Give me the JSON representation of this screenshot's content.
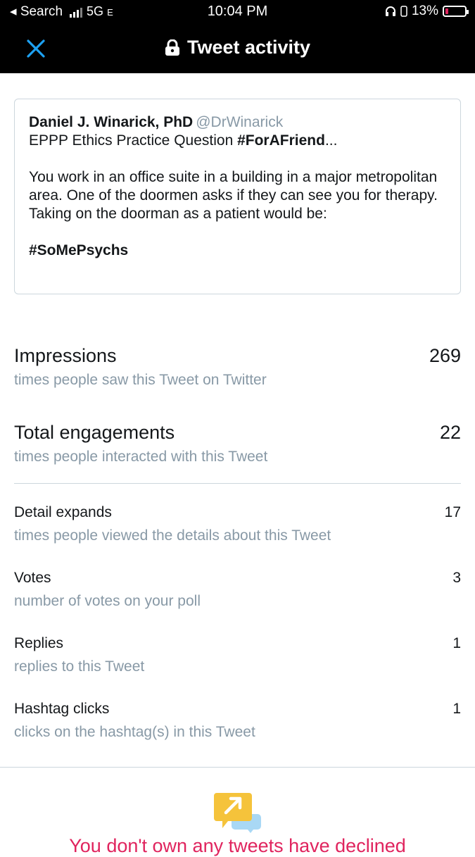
{
  "status_bar": {
    "back_app": "◂ Search",
    "network": "5G",
    "network_suffix": "E",
    "time": "10:04 PM",
    "battery": "13%"
  },
  "nav": {
    "title": "Tweet activity",
    "icons": {
      "close": "close-icon",
      "lock": "lock-icon"
    }
  },
  "tweet": {
    "author": "Daniel J. Winarick, PhD",
    "handle": "@DrWinarick",
    "line1_text": "EPPP Ethics Practice Question ",
    "line1_hashtag": "#ForAFriend",
    "line1_ellipsis": "...",
    "body": "You work in an office suite in a building in a major metropolitan area. One of the doormen asks if they can see you for therapy. Taking on the doorman as a patient would be:",
    "hashtag": "#SoMePsychs"
  },
  "metrics": [
    {
      "label": "Impressions",
      "desc": "times people saw this Tweet on Twitter",
      "value": "269"
    },
    {
      "label": "Total engagements",
      "desc": "times people interacted with this Tweet",
      "value": "22"
    },
    {
      "label": "Detail expands",
      "desc": "times people viewed the details about this Tweet",
      "value": "17"
    },
    {
      "label": "Votes",
      "desc": "number of votes on your poll",
      "value": "3"
    },
    {
      "label": "Replies",
      "desc": "replies to this Tweet",
      "value": "1"
    },
    {
      "label": "Hashtag clicks",
      "desc": "clicks on the hashtag(s) in this Tweet",
      "value": "1"
    }
  ],
  "promo": {
    "icon": "promote-tweet-icon",
    "text": "You don't own any tweets have declined"
  },
  "colors": {
    "accent": "#1da1f2",
    "secondary_text": "#8899a6",
    "promo": "#e0245e",
    "battery_low": "#e0245e"
  }
}
